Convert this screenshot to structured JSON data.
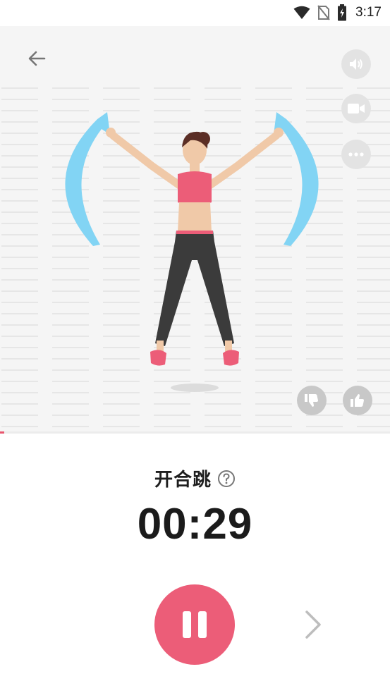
{
  "status_bar": {
    "time": "3:17",
    "icons": [
      "wifi-icon",
      "no-sim-icon",
      "battery-charging-icon"
    ]
  },
  "stage": {
    "background": "#f5f5f5",
    "back_icon": "arrow-left-icon",
    "side_buttons": [
      "volume-icon",
      "video-icon",
      "more-icon"
    ],
    "rating_buttons": [
      "thumbs-down-icon",
      "thumbs-up-icon"
    ],
    "arrow_color": "#7dd3f5"
  },
  "exercise": {
    "name": "开合跳",
    "help_icon": "help-icon",
    "timer": "00:29"
  },
  "controls": {
    "pause_icon": "pause-icon",
    "next_icon": "chevron-right-icon",
    "accent": "#ec5d78"
  }
}
